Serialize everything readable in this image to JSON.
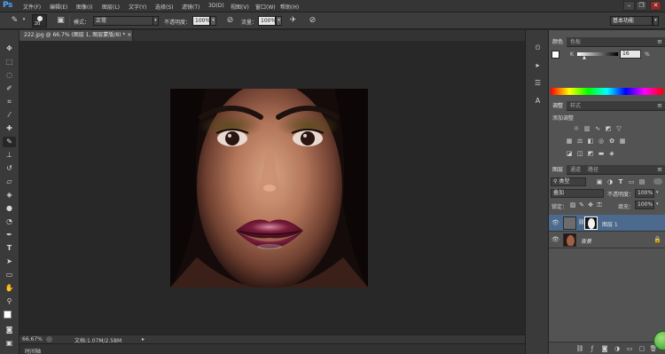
{
  "app": {
    "logo": "Ps"
  },
  "menu": [
    "文件(F)",
    "编辑(E)",
    "图像(I)",
    "图层(L)",
    "文字(Y)",
    "选择(S)",
    "滤镜(T)",
    "3D(D)",
    "视图(V)",
    "窗口(W)",
    "帮助(H)"
  ],
  "window_controls": {
    "minimize": "–",
    "restore": "❐",
    "close": "✕"
  },
  "options": {
    "brush_size": "20",
    "mode_label": "模式：",
    "mode_value": "正常",
    "opacity_label": "不透明度：",
    "opacity_value": "100%",
    "flow_label": "流量：",
    "flow_value": "100%",
    "workspace": "基本功能"
  },
  "document": {
    "tab_title": "222.jpg @ 66.7% (图层 1, 图层蒙版/8) * ",
    "tab_close": "×",
    "zoom": "66.67%",
    "doc_info": "文档:1.07M/2.58M"
  },
  "timeline": {
    "label": "时间轴"
  },
  "color_panel": {
    "tabs": [
      "颜色",
      "色板"
    ],
    "channel": "K",
    "value": "16",
    "unit": "%"
  },
  "adjustments_panel": {
    "tabs": [
      "调整",
      "样式"
    ],
    "title": "添加调整"
  },
  "layers_panel": {
    "tabs": [
      "图层",
      "通道",
      "路径"
    ],
    "filter": "类型",
    "blend_mode": "叠加",
    "opacity_label": "不透明度：",
    "opacity_value": "100%",
    "lock_label": "锁定：",
    "fill_label": "填充：",
    "fill_value": "100%",
    "layers": [
      {
        "name": "图层 1",
        "selected": true
      },
      {
        "name": "背景",
        "selected": false
      }
    ]
  },
  "colors": {
    "ps_blue": "#4aa7ff",
    "selected_layer": "#4b6a8d"
  }
}
